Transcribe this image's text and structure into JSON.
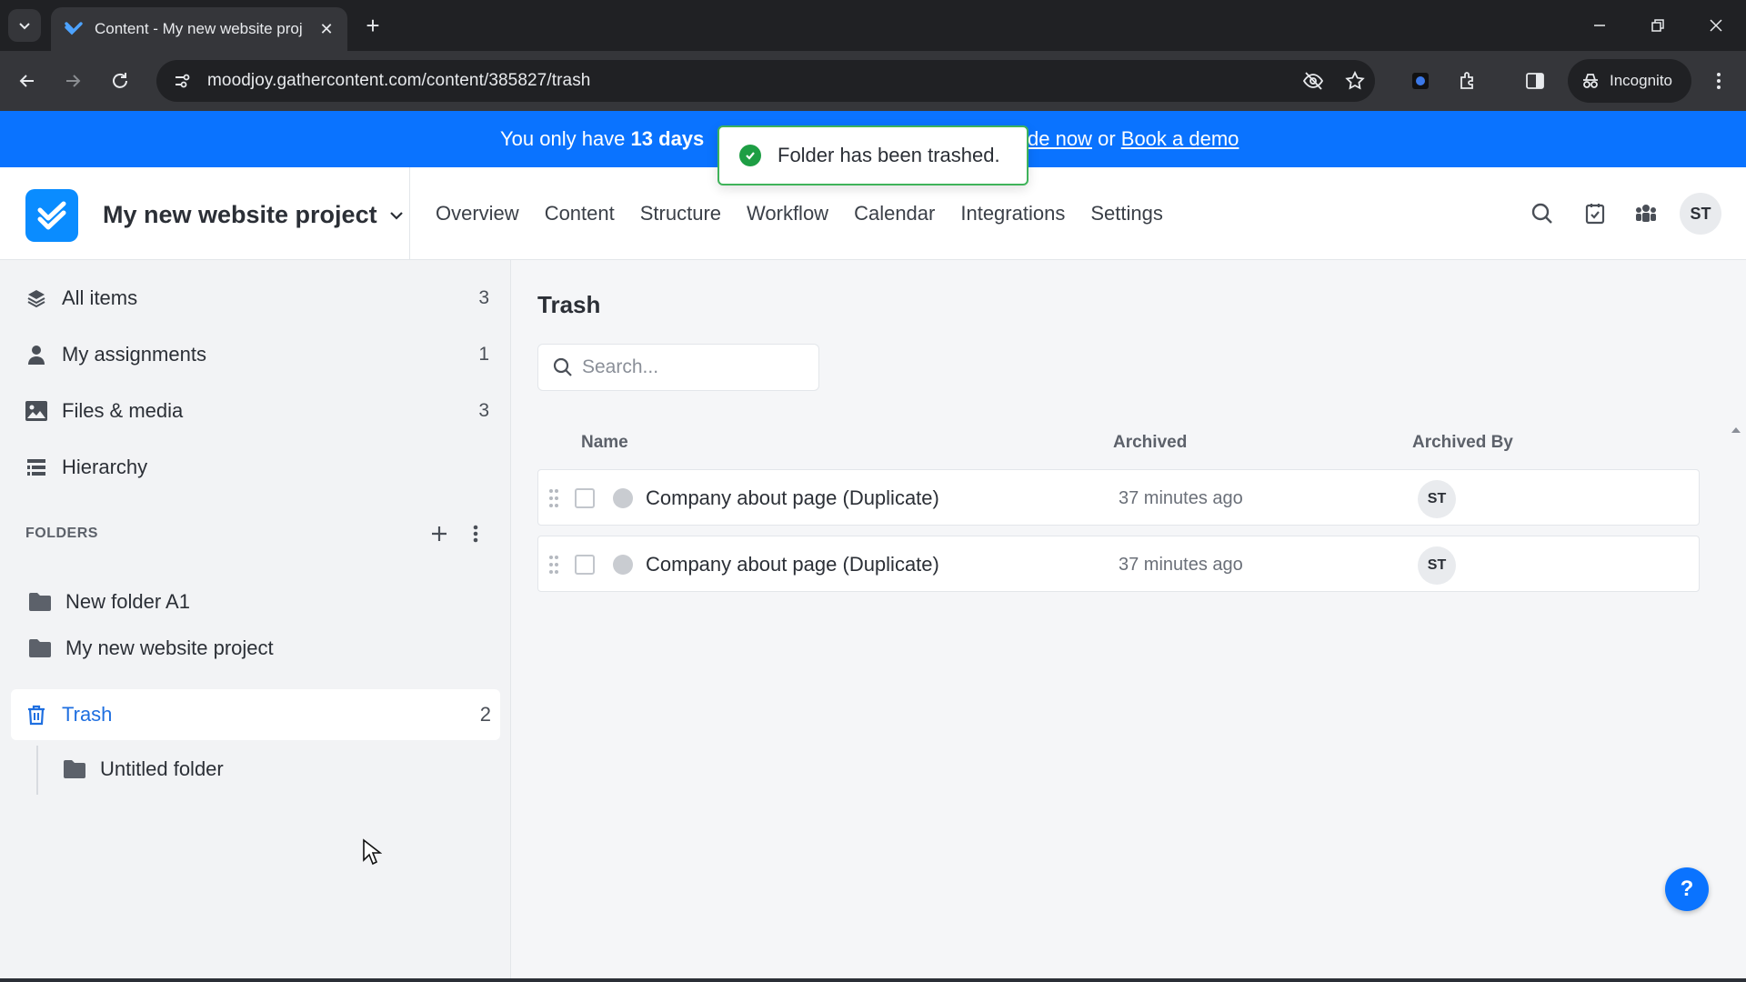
{
  "browser": {
    "tab_title": "Content - My new website proj",
    "url": "moodjoy.gathercontent.com/content/385827/trash",
    "incognito_label": "Incognito"
  },
  "banner": {
    "prefix": "You only have",
    "days": "13 days",
    "link1": "de now",
    "or": "or",
    "link2": "Book a demo"
  },
  "toast": {
    "message": "Folder has been trashed."
  },
  "header": {
    "project_name": "My new website project",
    "nav": [
      "Overview",
      "Content",
      "Structure",
      "Workflow",
      "Calendar",
      "Integrations",
      "Settings"
    ],
    "avatar": "ST"
  },
  "sidebar": {
    "items": [
      {
        "label": "All items",
        "count": "3",
        "icon": "layers-icon"
      },
      {
        "label": "My assignments",
        "count": "1",
        "icon": "person-icon"
      },
      {
        "label": "Files & media",
        "count": "3",
        "icon": "image-icon"
      },
      {
        "label": "Hierarchy",
        "count": "",
        "icon": "hierarchy-icon"
      }
    ],
    "folders_header": "FOLDERS",
    "folders": [
      {
        "label": "New folder A1"
      },
      {
        "label": "My new website project"
      }
    ],
    "trash": {
      "label": "Trash",
      "count": "2"
    },
    "trash_children": [
      {
        "label": "Untitled folder"
      }
    ]
  },
  "main": {
    "title": "Trash",
    "search_placeholder": "Search...",
    "columns": {
      "name": "Name",
      "archived": "Archived",
      "archived_by": "Archived By"
    },
    "rows": [
      {
        "name": "Company about page (Duplicate)",
        "archived": "37 minutes ago",
        "archived_by": "ST"
      },
      {
        "name": "Company about page (Duplicate)",
        "archived": "37 minutes ago",
        "archived_by": "ST"
      }
    ],
    "help_label": "?"
  },
  "colors": {
    "brand_blue": "#0a73ff",
    "success_green": "#1e9e44",
    "active_link": "#1f6fe0"
  }
}
